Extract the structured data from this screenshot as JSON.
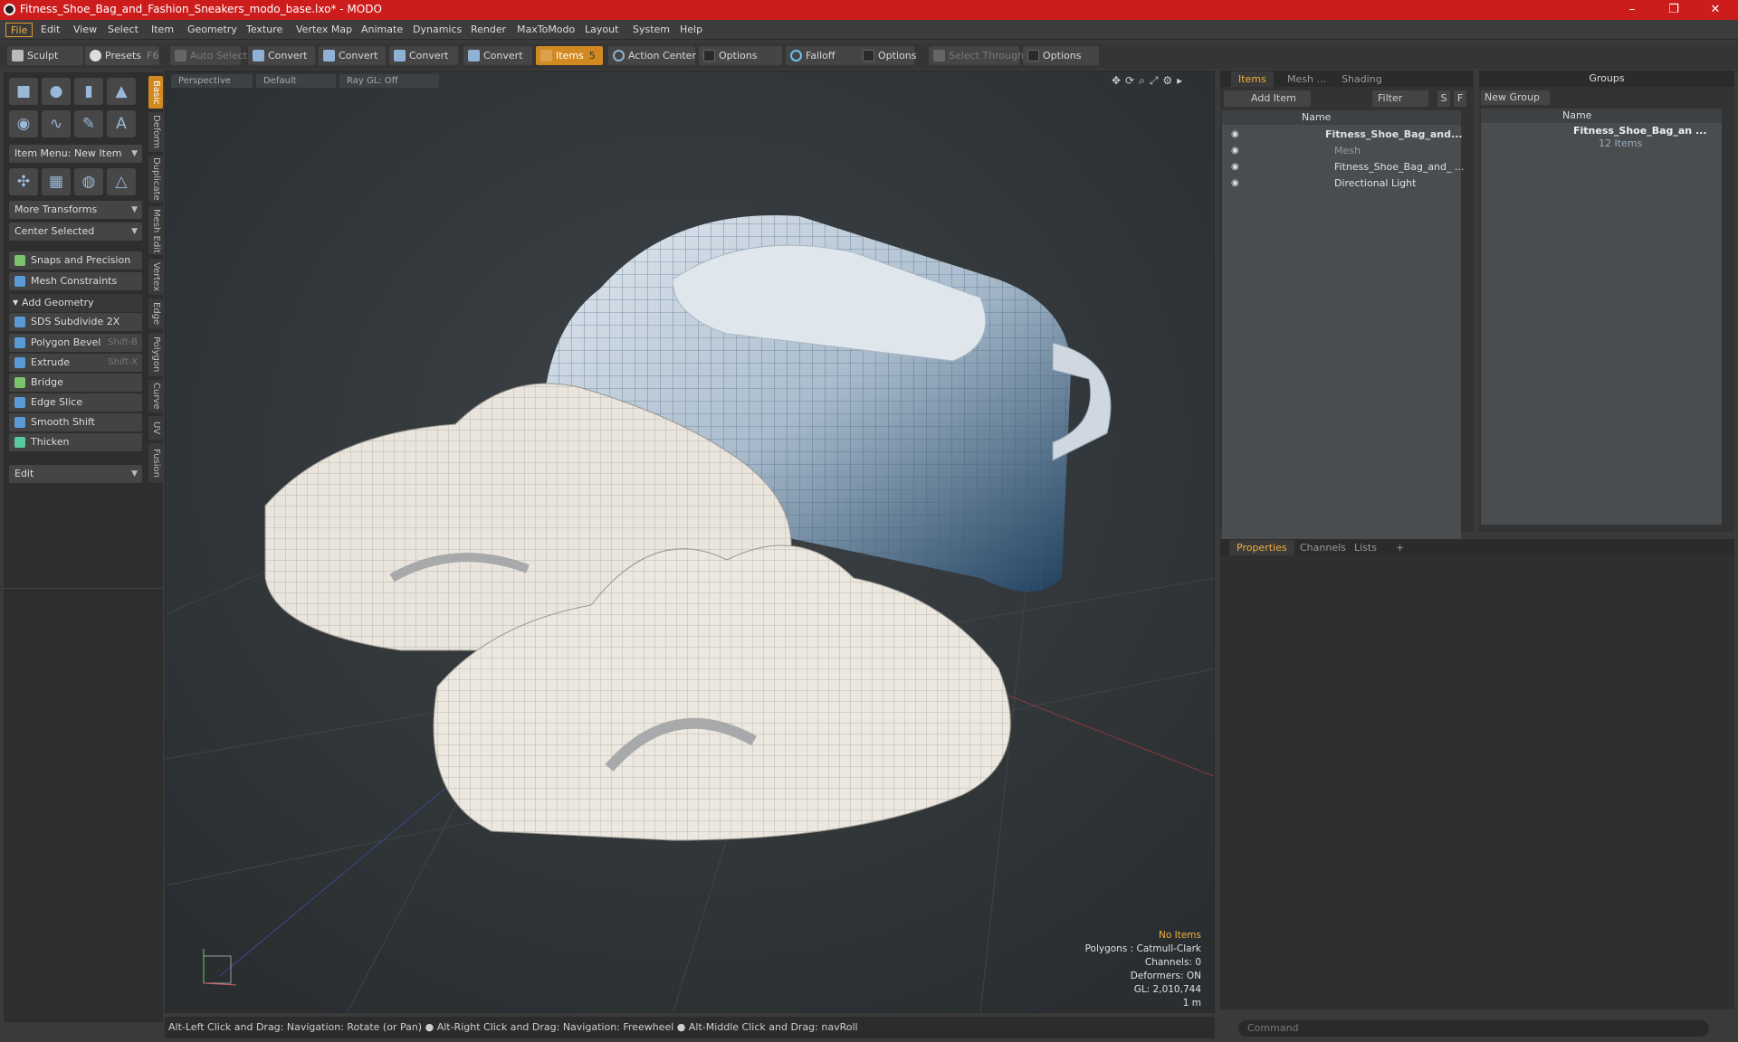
{
  "window": {
    "title": "Fitness_Shoe_Bag_and_Fashion_Sneakers_modo_base.lxo* - MODO",
    "minimize": "–",
    "maximize": "❐",
    "close": "✕"
  },
  "menu": [
    "File",
    "Edit",
    "View",
    "Select",
    "Item",
    "Geometry",
    "Texture",
    "Vertex Map",
    "Animate",
    "Dynamics",
    "Render",
    "MaxToModo",
    "Layout",
    "System",
    "Help"
  ],
  "toolbar": {
    "sculpt": "Sculpt",
    "presets": "Presets",
    "presets_key": "F6",
    "auto_select": "Auto Select",
    "convert1": "Convert",
    "convert2": "Convert",
    "convert3": "Convert",
    "convert4": "Convert",
    "items": "Items",
    "items_key": "5",
    "action_center": "Action Center",
    "options1": "Options",
    "falloff": "Falloff",
    "options2": "Options",
    "select_through": "Select Through",
    "options3": "Options"
  },
  "left": {
    "vtabs": [
      "Basic",
      "Deform",
      "Duplicate",
      "Mesh Edit",
      "Vertex",
      "Edge",
      "Polygon",
      "Curve",
      "UV",
      "Fusion"
    ],
    "item_menu": "Item Menu: New Item",
    "more_transforms": "More Transforms",
    "center_selected": "Center Selected",
    "snaps": "Snaps and Precision",
    "mesh_constraints": "Mesh Constraints",
    "add_geometry": "Add Geometry",
    "tools": [
      {
        "label": "SDS Subdivide 2X",
        "key": ""
      },
      {
        "label": "Polygon Bevel",
        "key": "Shift-B"
      },
      {
        "label": "Extrude",
        "key": "Shift-X"
      },
      {
        "label": "Bridge",
        "key": ""
      },
      {
        "label": "Edge Slice",
        "key": ""
      },
      {
        "label": "Smooth Shift",
        "key": ""
      },
      {
        "label": "Thicken",
        "key": ""
      }
    ],
    "edit": "Edit"
  },
  "viewport": {
    "perspective": "Perspective",
    "default": "Default",
    "raygl": "Ray GL: Off",
    "stats": {
      "no_items": "No Items",
      "polygons": "Polygons : Catmull-Clark",
      "channels": "Channels: 0",
      "deformers": "Deformers: ON",
      "gl": "GL: 2,010,744",
      "scale": "1 m"
    }
  },
  "status": "Alt-Left Click and Drag: Navigation: Rotate (or Pan) ● Alt-Right Click and Drag: Navigation: Freewheel ● Alt-Middle Click and Drag: navRoll",
  "items_panel": {
    "tabs": [
      "Items",
      "Mesh ...",
      "Shading"
    ],
    "add_item": "Add Item",
    "filter": "Filter Items",
    "s": "S",
    "f": "F",
    "name_col": "Name",
    "rows": [
      {
        "label": "Fitness_Shoe_Bag_and..."
      },
      {
        "label": "Mesh"
      },
      {
        "label": "Fitness_Shoe_Bag_and_ ..."
      },
      {
        "label": "Directional Light"
      }
    ]
  },
  "groups_panel": {
    "title": "Groups",
    "new_group": "New Group",
    "name_col": "Name",
    "group_name": "Fitness_Shoe_Bag_an ...",
    "group_count": "12 Items"
  },
  "properties": {
    "tabs": [
      "Properties",
      "Channels",
      "Lists"
    ],
    "plus": "+"
  },
  "command": {
    "placeholder": "Command"
  }
}
